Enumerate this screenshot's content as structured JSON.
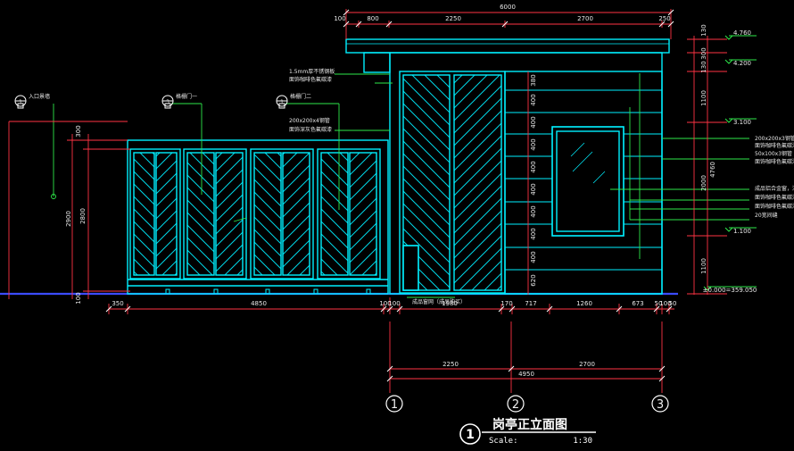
{
  "colors": {
    "background": "#000000",
    "wall": "#00f0ff",
    "dimension": "#ff3344",
    "leader": "#2ee84a",
    "ground": "#3b4bff",
    "text": "#ffffff"
  },
  "top_dimensions": [
    "6000",
    "100",
    "800",
    "2250",
    "2700",
    "250"
  ],
  "bottom_dimensions": [
    "350",
    "4850",
    "100",
    "100",
    "1980",
    "170",
    "717",
    "1260",
    "673",
    "50",
    "100",
    "50"
  ],
  "lower_dimensions": [
    "2250",
    "2700",
    "4950"
  ],
  "left_dimensions": [
    "300",
    "2900",
    "2800",
    "100"
  ],
  "panel_dimensions": [
    "380",
    "400",
    "400",
    "400",
    "400",
    "400",
    "400",
    "400",
    "400",
    "620"
  ],
  "right_dimensions": [
    "130",
    "300",
    "130",
    "1100",
    "2000",
    "4760",
    "1100"
  ],
  "elevations": [
    "4.760",
    "4.200",
    "3.100",
    "1.100",
    "±0.000=359.050"
  ],
  "callouts": [
    {
      "num": "1",
      "text": "入口景墙"
    },
    {
      "num": "3",
      "text": "格栅门一"
    },
    {
      "num": "1",
      "text": "格栅门二"
    }
  ],
  "notes_top": [
    "1.5mm厚不锈钢板",
    "面饰咖啡色氟碳漆",
    "200x200x4钢管",
    "面饰深灰色氟碳漆"
  ],
  "notes_right": [
    "200x200x3钢管",
    "面饰咖啡色氟碳漆",
    "50x100x3钢管",
    "面饰咖啡色氟碳漆",
    "成品铝合金窗，深色铝合金窗框",
    "面饰咖啡色氟碳漆饰面",
    "面饰咖啡色氟碳漆饰面",
    "20宽间缝"
  ],
  "door_note": "成品窗网（成品购买）",
  "axes": [
    "1",
    "2",
    "3"
  ],
  "title": {
    "num": "1",
    "text": "岗亭正立面图",
    "scale_label": "Scale:",
    "scale_value": "1:30"
  }
}
